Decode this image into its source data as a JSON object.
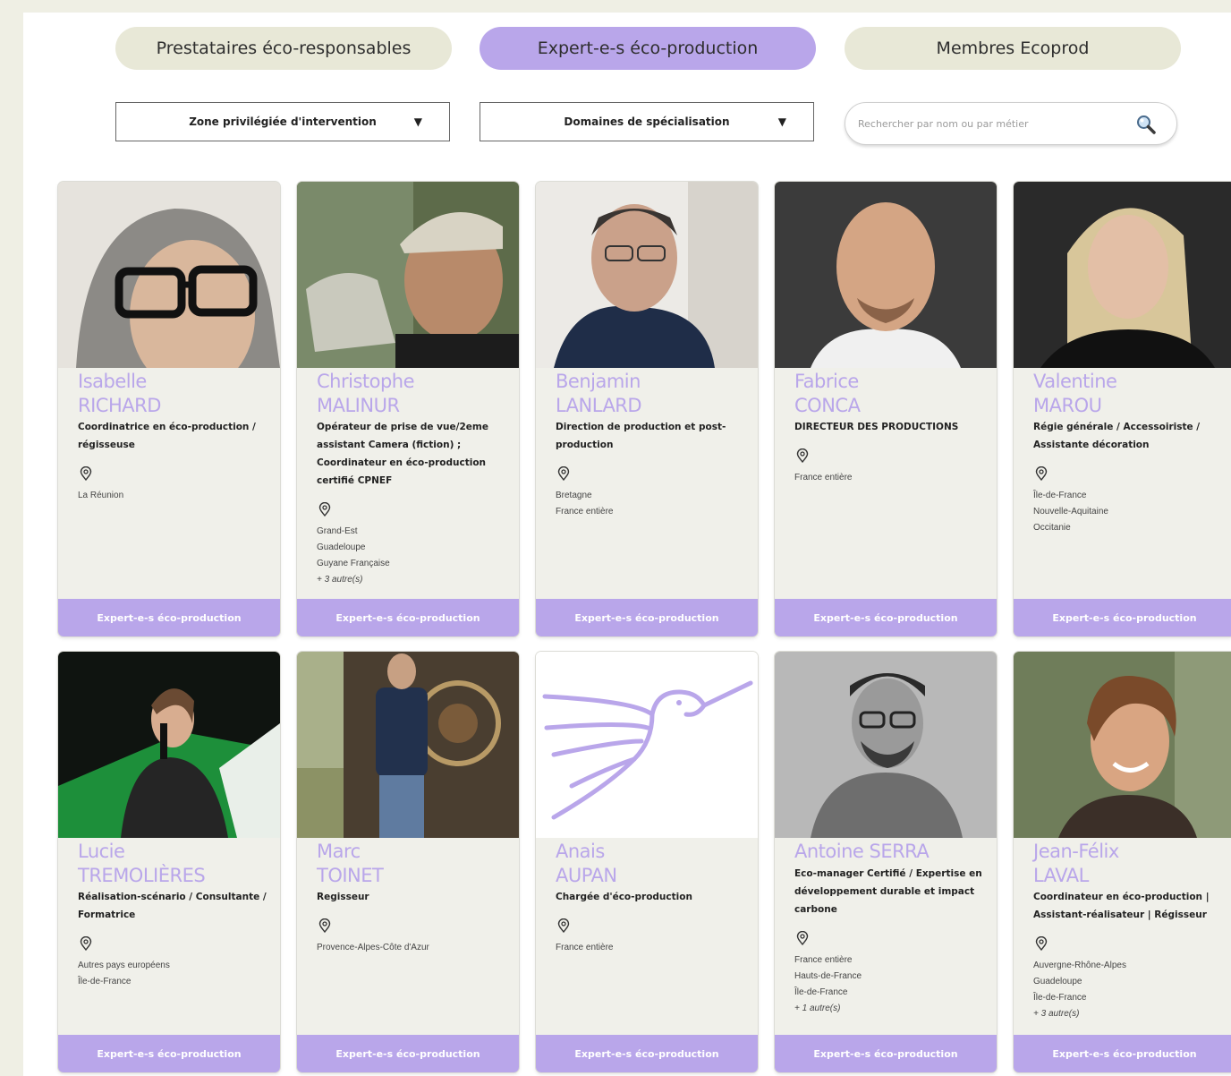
{
  "tabs": [
    {
      "label": "Prestataires éco-responsables",
      "active": false
    },
    {
      "label": "Expert-e-s éco-production",
      "active": true
    },
    {
      "label": "Membres Ecoprod",
      "active": false
    }
  ],
  "filters": {
    "zone_label": "Zone privilégiée d'intervention",
    "domain_label": "Domaines de spécialisation",
    "search_placeholder": "Rechercher par nom ou par métier"
  },
  "icons": {
    "pin": "map-pin-icon",
    "search": "magnifier-icon",
    "dropdown": "triangle-down-icon"
  },
  "colors": {
    "accent": "#b9a6ea",
    "tab_idle": "#e8e8d7",
    "card_bg": "#f0f0ea"
  },
  "cards": [
    {
      "first": "Isabelle",
      "last": "RICHARD",
      "role": "Coordinatrice en éco-production / régisseuse",
      "zones": [
        "La Réunion"
      ],
      "more": "",
      "tag": "Expert-e-s éco-production"
    },
    {
      "first": "Christophe",
      "last": "MALINUR",
      "role": "Opérateur de prise de vue/2eme assistant Camera (fiction) ; Coordinateur en éco-production certifié CPNEF",
      "zones": [
        "Grand-Est",
        "Guadeloupe",
        "Guyane Française"
      ],
      "more": "+ 3 autre(s)",
      "tag": "Expert-e-s éco-production"
    },
    {
      "first": "Benjamin",
      "last": "LANLARD",
      "role": "Direction de production et post-production",
      "zones": [
        "Bretagne",
        "France entière"
      ],
      "more": "",
      "tag": "Expert-e-s éco-production"
    },
    {
      "first": "Fabrice",
      "last": "CONCA",
      "role": "DIRECTEUR DES PRODUCTIONS",
      "zones": [
        "France entière"
      ],
      "more": "",
      "tag": "Expert-e-s éco-production"
    },
    {
      "first": "Valentine",
      "last": "MAROU",
      "role": "Régie générale / Accessoiriste / Assistante décoration",
      "zones": [
        "Île-de-France",
        "Nouvelle-Aquitaine",
        "Occitanie"
      ],
      "more": "",
      "tag": "Expert-e-s éco-production"
    },
    {
      "first": "Lucie",
      "last": "TREMOLIÈRES",
      "role": "Réalisation-scénario / Consultante / Formatrice",
      "zones": [
        "Autres pays européens",
        "Île-de-France"
      ],
      "more": "",
      "tag": "Expert-e-s éco-production"
    },
    {
      "first": "Marc",
      "last": "TOINET",
      "role": "Regisseur",
      "zones": [
        "Provence-Alpes-Côte d'Azur"
      ],
      "more": "",
      "tag": "Expert-e-s éco-production"
    },
    {
      "first": "Anais",
      "last": "AUPAN",
      "role": "Chargée d'éco-production",
      "zones": [
        "France entière"
      ],
      "more": "",
      "tag": "Expert-e-s éco-production"
    },
    {
      "first": "Antoine SERRA",
      "last": "",
      "role": "Eco-manager Certifié / Expertise en développement durable et impact carbone",
      "zones": [
        "France entière",
        "Hauts-de-France",
        "Île-de-France"
      ],
      "more": "+ 1 autre(s)",
      "tag": "Expert-e-s éco-production"
    },
    {
      "first": "Jean-Félix",
      "last": "LAVAL",
      "role": "Coordinateur en éco-production | Assistant-réalisateur | Régisseur",
      "zones": [
        "Auvergne-Rhône-Alpes",
        "Guadeloupe",
        "Île-de-France"
      ],
      "more": "+ 3 autre(s)",
      "tag": "Expert-e-s éco-production"
    }
  ]
}
